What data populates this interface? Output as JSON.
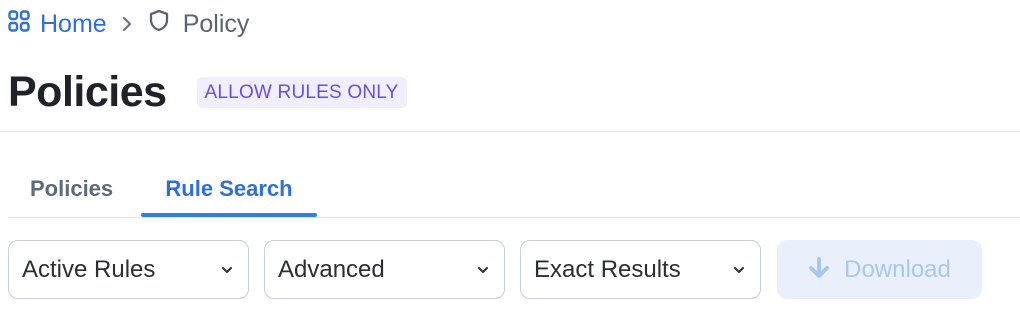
{
  "breadcrumb": {
    "home_label": "Home",
    "home_icon": "grid-icon",
    "separator_icon": "chevron-right-icon",
    "current_label": "Policy",
    "current_icon": "shield-icon"
  },
  "page": {
    "title": "Policies",
    "badge": "ALLOW RULES ONLY"
  },
  "tabs": [
    {
      "label": "Policies",
      "active": false
    },
    {
      "label": "Rule Search",
      "active": true
    }
  ],
  "filters": [
    {
      "value": "Active Rules",
      "icon": "chevron-down-icon"
    },
    {
      "value": "Advanced",
      "icon": "chevron-down-icon"
    },
    {
      "value": "Exact Results",
      "icon": "chevron-down-icon"
    }
  ],
  "download": {
    "label": "Download",
    "icon": "download-arrow-icon",
    "enabled": false
  },
  "colors": {
    "accent": "#2f6fd6",
    "badge_bg": "#f1efff",
    "badge_text": "#6b4fd6",
    "download_bg": "#e9f0fb",
    "download_text": "#a9c8ee"
  }
}
